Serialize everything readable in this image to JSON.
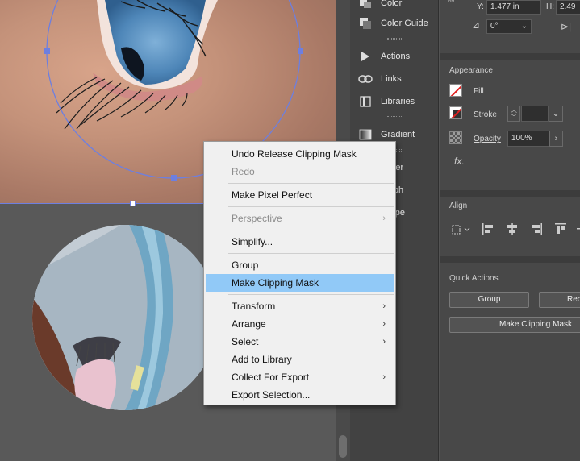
{
  "context_menu": {
    "items": [
      {
        "label": "Undo Release Clipping Mask",
        "enabled": true
      },
      {
        "label": "Redo",
        "enabled": false
      },
      {
        "label": "Make Pixel Perfect",
        "enabled": true
      },
      {
        "label": "Perspective",
        "enabled": false,
        "submenu": true
      },
      {
        "label": "Simplify...",
        "enabled": true
      },
      {
        "label": "Group",
        "enabled": true
      },
      {
        "label": "Make Clipping Mask",
        "enabled": true,
        "highlighted": true
      },
      {
        "label": "Transform",
        "enabled": true,
        "submenu": true
      },
      {
        "label": "Arrange",
        "enabled": true,
        "submenu": true
      },
      {
        "label": "Select",
        "enabled": true,
        "submenu": true
      },
      {
        "label": "Add to Library",
        "enabled": true
      },
      {
        "label": "Collect For Export",
        "enabled": true,
        "submenu": true
      },
      {
        "label": "Export Selection...",
        "enabled": true
      }
    ],
    "submenu_arrow": "›"
  },
  "dock": {
    "items": [
      {
        "label": "Color",
        "icon": "color-icon"
      },
      {
        "label": "Color Guide",
        "icon": "color-guide-icon"
      },
      {
        "label": "Actions",
        "icon": "play-icon"
      },
      {
        "label": "Links",
        "icon": "link-icon"
      },
      {
        "label": "Libraries",
        "icon": "libraries-icon"
      },
      {
        "label": "Gradient",
        "icon": "gradient-icon"
      },
      {
        "label": "racter"
      },
      {
        "label": "graph"
      },
      {
        "label": "nType"
      }
    ]
  },
  "properties": {
    "transform": {
      "y_label": "Y:",
      "y_value": "1.477 in",
      "h_label": "H:",
      "h_value": "2.49",
      "rotate_value": "0°"
    },
    "appearance": {
      "title": "Appearance",
      "fill_label": "Fill",
      "stroke_label": "Stroke",
      "opacity_label": "Opacity",
      "opacity_value": "100%",
      "fx_label": "fx."
    },
    "align": {
      "title": "Align"
    },
    "quick_actions": {
      "title": "Quick Actions",
      "group_button": "Group",
      "recolor_button": "Reco",
      "clip_button": "Make Clipping Mask"
    }
  },
  "colors": {
    "menu_highlight": "#91c9f7",
    "selection": "#6d7fe0",
    "fill_none_slash": "#e02020"
  }
}
